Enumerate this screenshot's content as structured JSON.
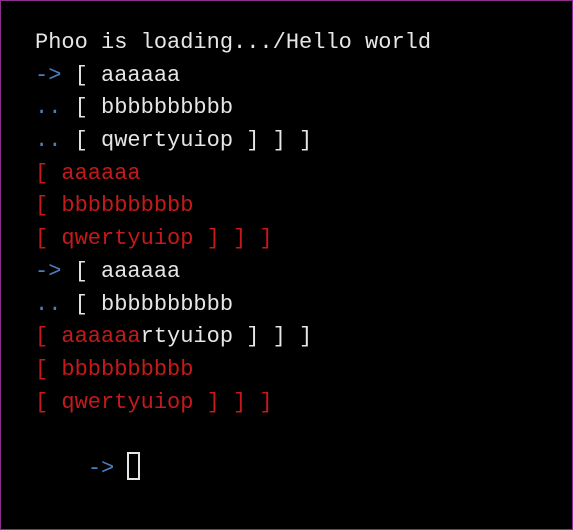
{
  "terminal": {
    "lines": [
      [
        {
          "text": "Phoo is loading.../Hello world",
          "color": "white"
        }
      ],
      [
        {
          "text": "-> ",
          "color": "blue"
        },
        {
          "text": "[ aaaaaa",
          "color": "white"
        }
      ],
      [
        {
          "text": ".. ",
          "color": "blue"
        },
        {
          "text": "[ bbbbbbbbbb",
          "color": "white"
        }
      ],
      [
        {
          "text": ".. ",
          "color": "blue"
        },
        {
          "text": "[ qwertyuiop ] ] ]",
          "color": "white"
        }
      ],
      [
        {
          "text": "[ aaaaaa",
          "color": "red"
        }
      ],
      [
        {
          "text": "[ bbbbbbbbbb",
          "color": "red"
        }
      ],
      [
        {
          "text": "[ qwertyuiop ] ] ]",
          "color": "red"
        }
      ],
      [
        {
          "text": "-> ",
          "color": "blue"
        },
        {
          "text": "[ aaaaaa",
          "color": "white"
        }
      ],
      [
        {
          "text": ".. ",
          "color": "blue"
        },
        {
          "text": "[ bbbbbbbbbb",
          "color": "white"
        }
      ],
      [
        {
          "text": "[ aaaaaa",
          "color": "red"
        },
        {
          "text": "rtyuiop ] ] ]",
          "color": "white"
        }
      ],
      [
        {
          "text": "[ bbbbbbbbbb",
          "color": "red"
        }
      ],
      [
        {
          "text": "[ qwertyuiop ] ] ]",
          "color": "red"
        }
      ]
    ],
    "prompt": "-> ",
    "colors": {
      "background": "#000000",
      "text": "#e6e6e6",
      "prompt": "#4a7fc0",
      "error": "#c41a1a",
      "border": "#8b2f8b"
    }
  }
}
